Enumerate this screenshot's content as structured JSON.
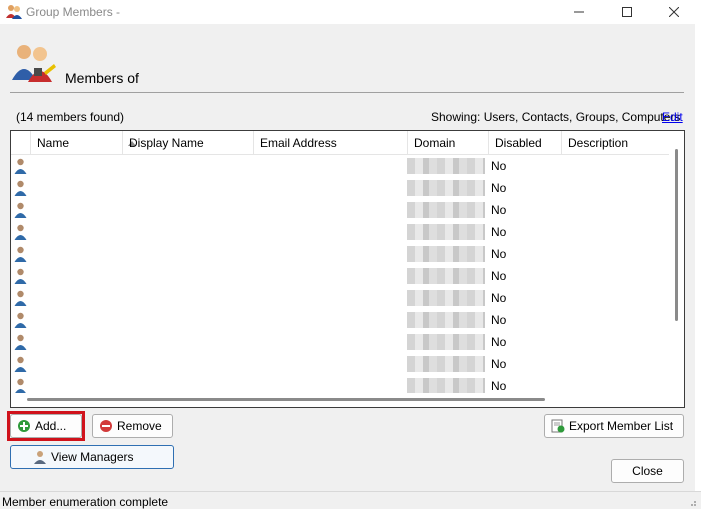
{
  "window": {
    "title": "Group Members -",
    "controls": {
      "minimize": "minimize-icon",
      "maximize": "maximize-icon",
      "close": "close-icon"
    }
  },
  "header": {
    "label": "Members of",
    "icon": "users-group-icon"
  },
  "summary": {
    "found": "(14 members found)",
    "showing": "Showing:  Users, Contacts, Groups, Computers",
    "edit_link": "Edit"
  },
  "table": {
    "columns": [
      "Name",
      "Display Name",
      "Email Address",
      "Domain",
      "Disabled",
      "Description"
    ],
    "sorted_column": "Name",
    "sort_direction": "ascending",
    "rows": [
      {
        "disabled": "No"
      },
      {
        "disabled": "No"
      },
      {
        "disabled": "No"
      },
      {
        "disabled": "No"
      },
      {
        "disabled": "No"
      },
      {
        "disabled": "No"
      },
      {
        "disabled": "No"
      },
      {
        "disabled": "No"
      },
      {
        "disabled": "No"
      },
      {
        "disabled": "No"
      },
      {
        "disabled": "No"
      }
    ]
  },
  "buttons": {
    "add": "Add...",
    "remove": "Remove",
    "export": "Export Member List",
    "view_managers": "View Managers",
    "close": "Close"
  },
  "status": {
    "text": "Member enumeration complete"
  },
  "colors": {
    "highlight": "#d0121b",
    "link": "#0000ee",
    "dialog_bg": "#f0f0f0"
  }
}
